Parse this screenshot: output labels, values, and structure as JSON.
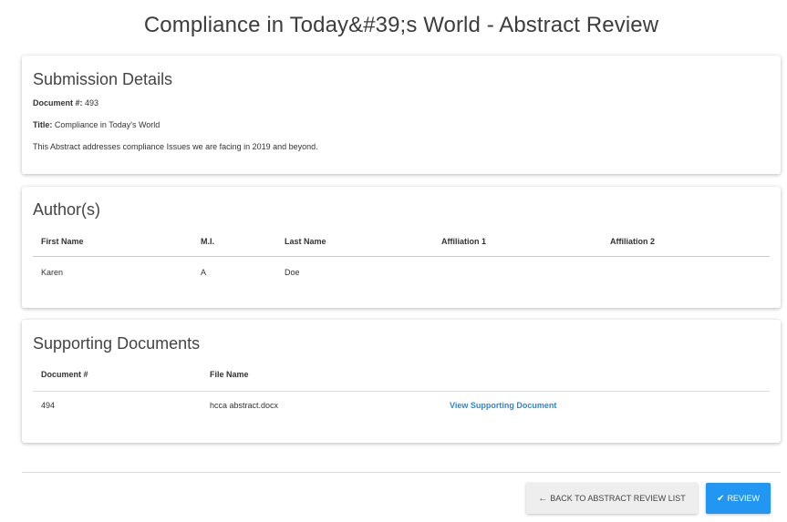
{
  "page": {
    "title": "Compliance in Today&#39;s World - Abstract Review"
  },
  "submission": {
    "heading": "Submission Details",
    "document_label": "Document #:",
    "document_value": "493",
    "title_label": "Title:",
    "title_value": "Compliance in Today's World",
    "description": "This Abstract addresses compliance Issues we are facing in 2019 and beyond."
  },
  "authors": {
    "heading": "Author(s)",
    "columns": [
      "First Name",
      "M.I.",
      "Last Name",
      "Affiliation 1",
      "Affiliation 2"
    ],
    "rows": [
      {
        "first_name": "Karen",
        "mi": "A",
        "last_name": "Doe",
        "affiliation1": "",
        "affiliation2": ""
      }
    ]
  },
  "documents": {
    "heading": "Supporting Documents",
    "columns": [
      "Document #",
      "File Name"
    ],
    "rows": [
      {
        "number": "494",
        "file_name": "hcca abstract.docx",
        "link": "View Supporting Document"
      }
    ]
  },
  "actions": {
    "back_label": "Back to Abstract Review List",
    "back_icon": "arrow-left-icon",
    "review_label": "Review",
    "review_icon": "check-icon",
    "review_color": "#2196f3"
  }
}
